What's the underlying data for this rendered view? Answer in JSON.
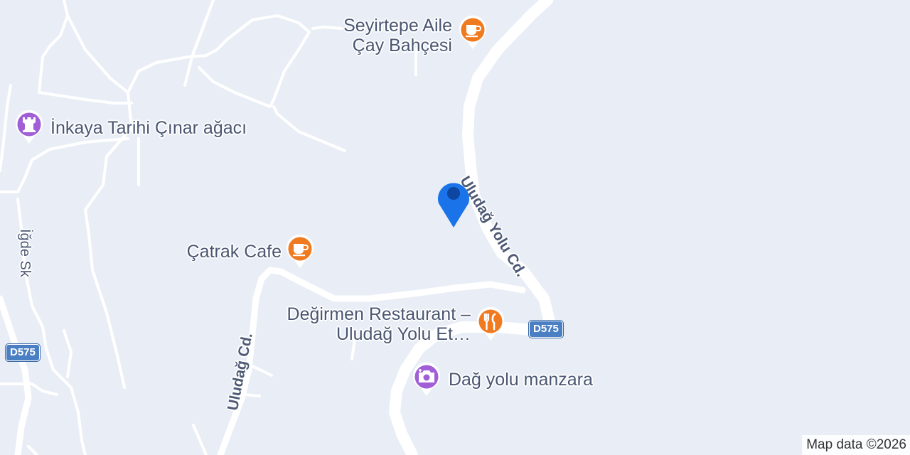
{
  "map": {
    "pois": [
      {
        "name_lines": [
          "Seyirtepe Aile",
          "Çay Bahçesi"
        ],
        "icon": "coffee-cup-icon",
        "color": "#f07a1f"
      },
      {
        "name_lines": [
          "İnkaya Tarihi Çınar ağacı"
        ],
        "icon": "tower-icon",
        "color": "#a05fd6"
      },
      {
        "name_lines": [
          "Çatrak Cafe"
        ],
        "icon": "coffee-cup-icon",
        "color": "#f07a1f"
      },
      {
        "name_lines": [
          "Değirmen Restaurant –",
          "Uludağ Yolu Et…"
        ],
        "icon": "fork-knife-icon",
        "color": "#f07a1f"
      },
      {
        "name_lines": [
          "Dağ yolu manzara"
        ],
        "icon": "camera-icon",
        "color": "#a05fd6"
      }
    ],
    "roads": [
      "Uludağ Yolu Cd.",
      "Uludağ Cd.",
      "İğde Sk"
    ],
    "shields": [
      "D575",
      "D575"
    ],
    "location_marker": {
      "icon": "location-pin-icon",
      "color": "#1a73e8"
    },
    "attribution": "Map data ©2026"
  }
}
